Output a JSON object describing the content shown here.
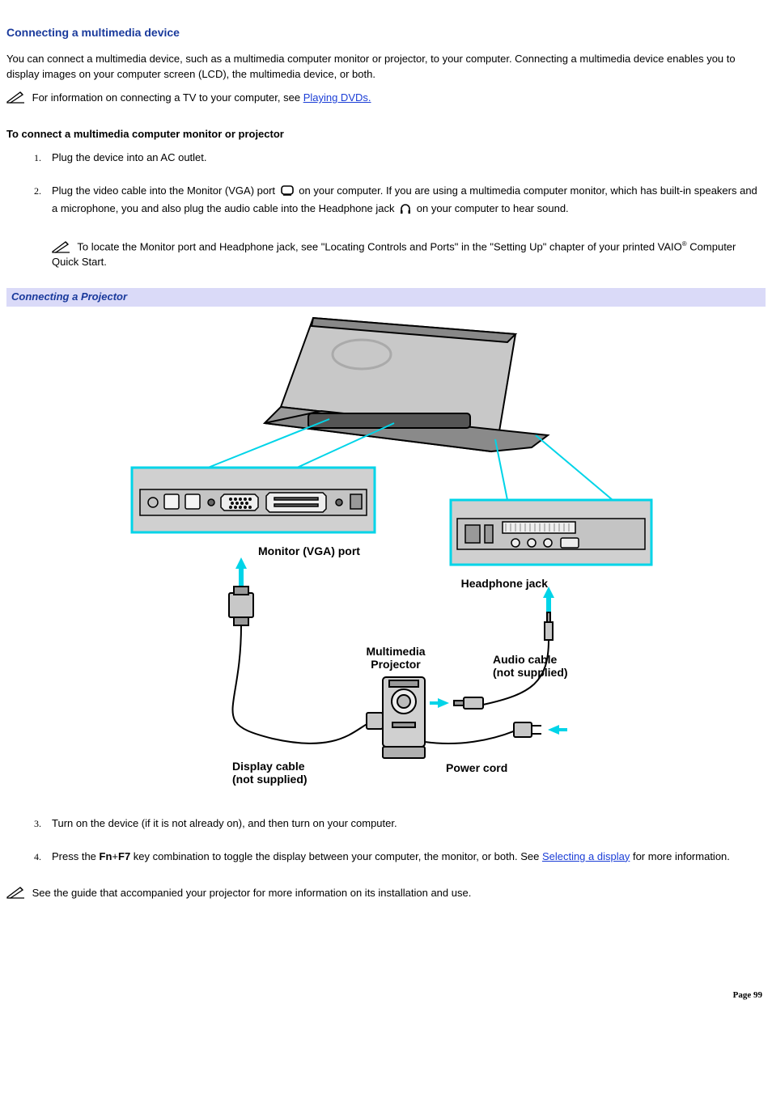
{
  "title": "Connecting a multimedia device",
  "intro": "You can connect a multimedia device, such as a multimedia computer monitor or projector, to your computer. Connecting a multimedia device enables you to display images on your computer screen (LCD), the multimedia device, or both.",
  "tv_note_pre": "For information on connecting a TV to your computer, see ",
  "tv_note_link": "Playing DVDs.",
  "subhead": "To connect a multimedia computer monitor or projector",
  "step1": "Plug the device into an AC outlet.",
  "step2_a": "Plug the video cable into the Monitor (VGA) port ",
  "step2_b": " on your computer. If you are using a multimedia computer monitor, which has built-in speakers and a microphone, you and also plug the audio cable into the Headphone jack ",
  "step2_c": " on your computer to hear sound.",
  "locate_note_a": "To locate the Monitor port and Headphone jack, see \"Locating Controls and Ports\" in the \"Setting Up\" chapter of your printed VAIO",
  "locate_note_b": " Computer Quick Start.",
  "figure_caption": "Connecting a Projector",
  "fig_labels": {
    "vga": "Monitor (VGA) port",
    "headphone": "Headphone jack",
    "projector_a": "Multimedia",
    "projector_b": "Projector",
    "audio_a": "Audio cable",
    "audio_b": "(not supplied)",
    "display_a": "Display cable",
    "display_b": "(not supplied)",
    "power": "Power cord"
  },
  "step3": "Turn on the device (if it is not already on), and then turn on your computer.",
  "step4_a": "Press the ",
  "step4_key1": "Fn",
  "step4_plus": "+",
  "step4_key2": "F7",
  "step4_b": " key combination to toggle the display between your computer, the monitor, or both. See ",
  "step4_link": "Selecting a display",
  "step4_c": " for more information.",
  "final_note": "See the guide that accompanied your projector for more information on its installation and use.",
  "page": "Page 99"
}
